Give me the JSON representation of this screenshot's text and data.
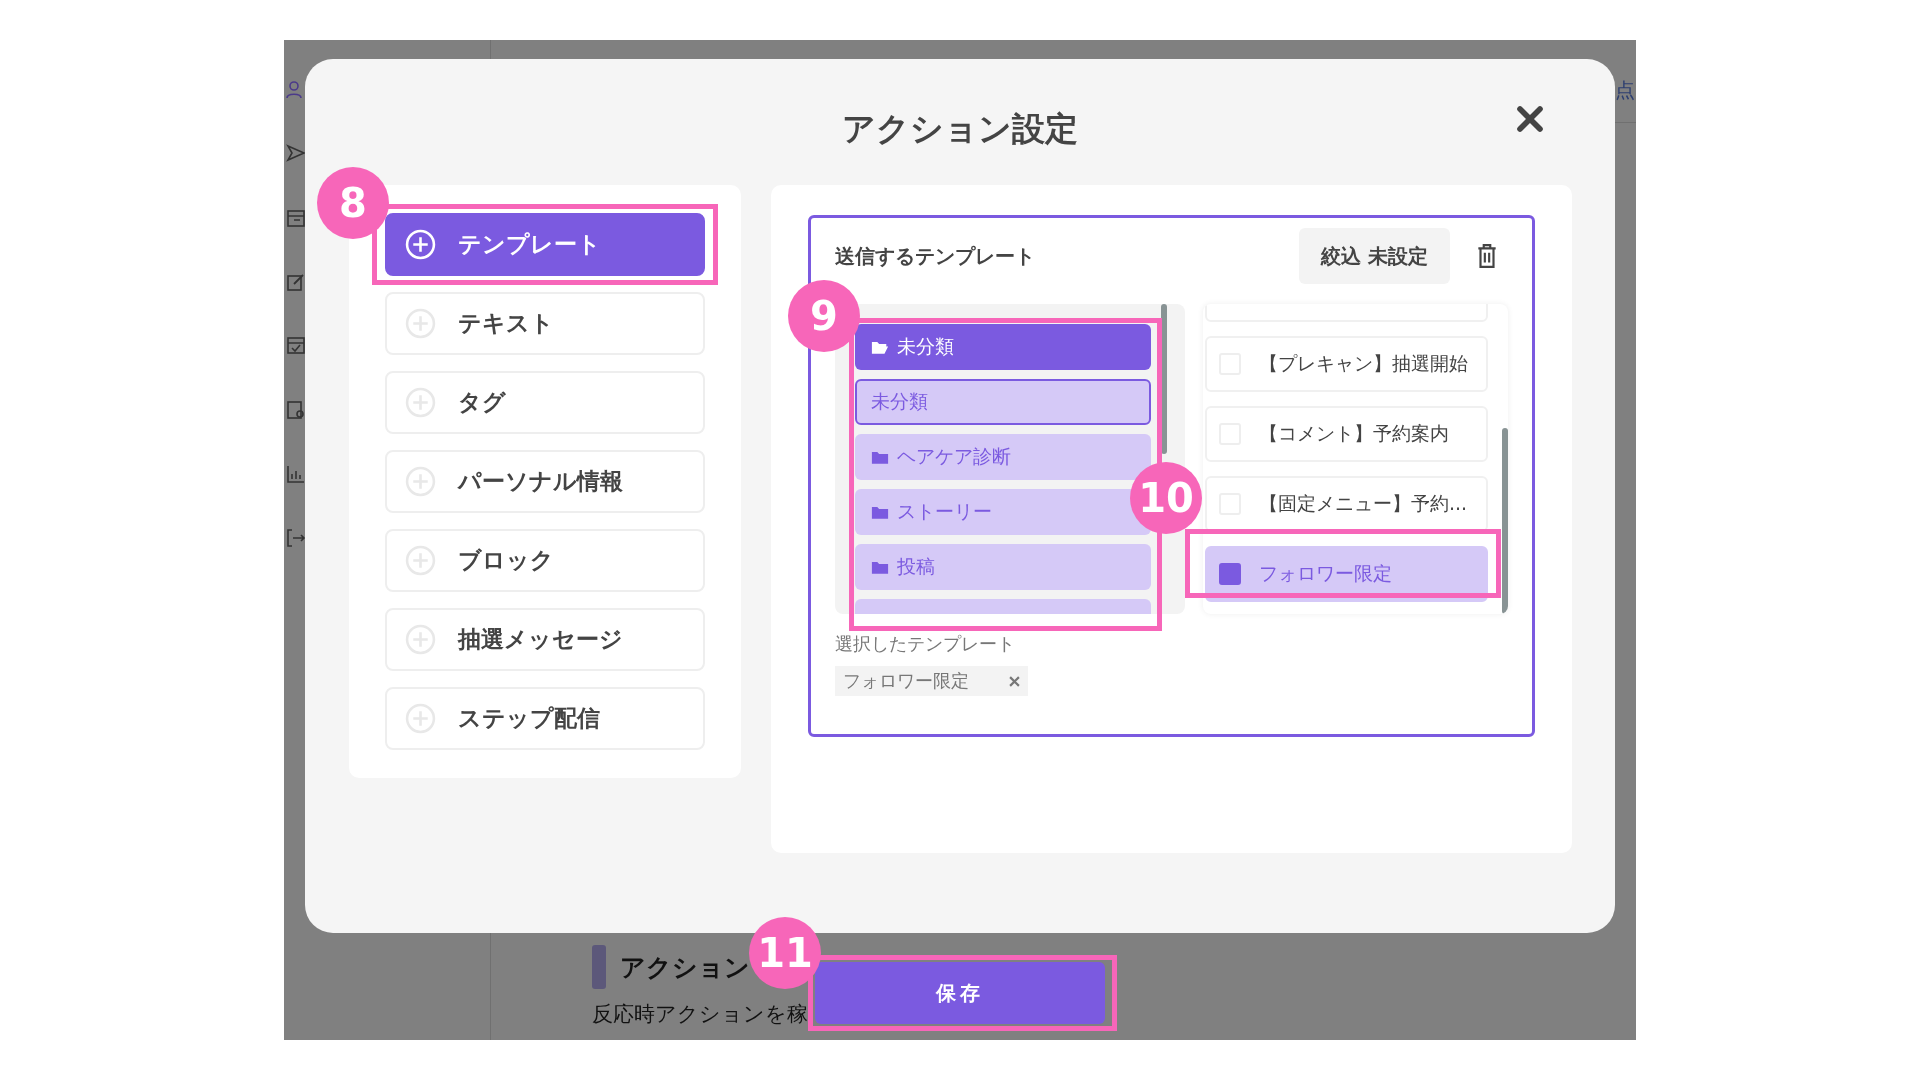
{
  "background_page": {
    "corner_text": "点",
    "section_title": "アクション",
    "description": "反応時アクションを稼"
  },
  "modal": {
    "title": "アクション設定"
  },
  "action_types": [
    {
      "label": "テンプレート",
      "selected": true
    },
    {
      "label": "テキスト",
      "selected": false
    },
    {
      "label": "タグ",
      "selected": false
    },
    {
      "label": "パーソナル情報",
      "selected": false
    },
    {
      "label": "ブロック",
      "selected": false
    },
    {
      "label": "抽選メッセージ",
      "selected": false
    },
    {
      "label": "ステップ配信",
      "selected": false
    }
  ],
  "template_panel": {
    "heading": "送信するテンプレート",
    "filter_button": "絞込 未設定",
    "folders": [
      {
        "label": "未分類",
        "kind": "open-folder",
        "selected": true
      },
      {
        "label": "未分類",
        "kind": "plain",
        "selected": false
      },
      {
        "label": "ヘアケア診断",
        "kind": "folder",
        "selected": false
      },
      {
        "label": "ストーリー",
        "kind": "folder",
        "selected": false
      },
      {
        "label": "投稿",
        "kind": "folder",
        "selected": false
      }
    ],
    "templates": [
      {
        "label": "【プレキャン】抽選開始",
        "checked": false
      },
      {
        "label": "【コメント】予約案内",
        "checked": false
      },
      {
        "label": "【固定メニュー】予約...",
        "checked": false
      },
      {
        "label": "フォロワー限定",
        "checked": true
      }
    ],
    "selected_label": "選択したテンプレート",
    "selected_chips": [
      {
        "label": "フォロワー限定"
      }
    ]
  },
  "save_button": "保存",
  "annotations": [
    {
      "number": "8"
    },
    {
      "number": "9"
    },
    {
      "number": "10"
    },
    {
      "number": "11"
    }
  ]
}
